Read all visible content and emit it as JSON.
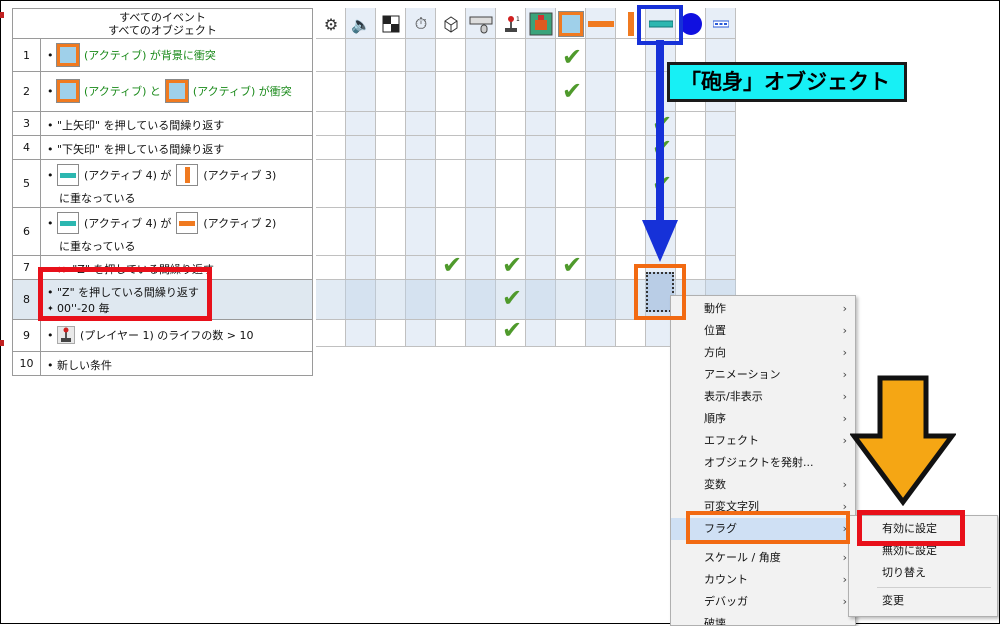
{
  "header": {
    "line1": "すべてのイベント",
    "line2": "すべてのオブジェクト"
  },
  "events": [
    {
      "num": "1",
      "parts": [
        "(アクティブ) が背景に衝突"
      ]
    },
    {
      "num": "2",
      "parts": [
        "(アクティブ) と",
        "(アクティブ) が衝突"
      ]
    },
    {
      "num": "3",
      "parts": [
        "\"上矢印\" を押している間繰り返す"
      ]
    },
    {
      "num": "4",
      "parts": [
        "\"下矢印\" を押している間繰り返す"
      ]
    },
    {
      "num": "5",
      "parts": [
        "(アクティブ 4) が",
        "(アクティブ 3)",
        "に重なっている"
      ]
    },
    {
      "num": "6",
      "parts": [
        "(アクティブ 4) が",
        "(アクティブ 2)",
        "に重なっている"
      ]
    },
    {
      "num": "7",
      "parts": [
        "\"Z\" を押している間繰り返す"
      ]
    },
    {
      "num": "8",
      "parts": [
        "\"Z\" を押している間繰り返す",
        "00''-20 毎"
      ]
    },
    {
      "num": "9",
      "parts": [
        "(プレイヤー 1) のライフの数 > 10"
      ]
    },
    {
      "num": "10",
      "parts": [
        "新しい条件"
      ]
    }
  ],
  "callout": "「砲身」オブジェクト",
  "context_menu": [
    "動作",
    "位置",
    "方向",
    "アニメーション",
    "表示/非表示",
    "順序",
    "エフェクト",
    "オブジェクトを発射...",
    "変数",
    "可変文字列",
    "フラグ",
    "スケール / 角度",
    "カウント",
    "デバッガ",
    "破壊"
  ],
  "submenu": [
    "有効に設定",
    "無効に設定",
    "切り替え",
    "変更"
  ],
  "colors": {
    "highlight_red": "#e8101a",
    "highlight_orange": "#f26a12",
    "highlight_blue": "#1631d8",
    "callout_bg": "#17f0f5",
    "check_green": "#4f9a2c"
  }
}
